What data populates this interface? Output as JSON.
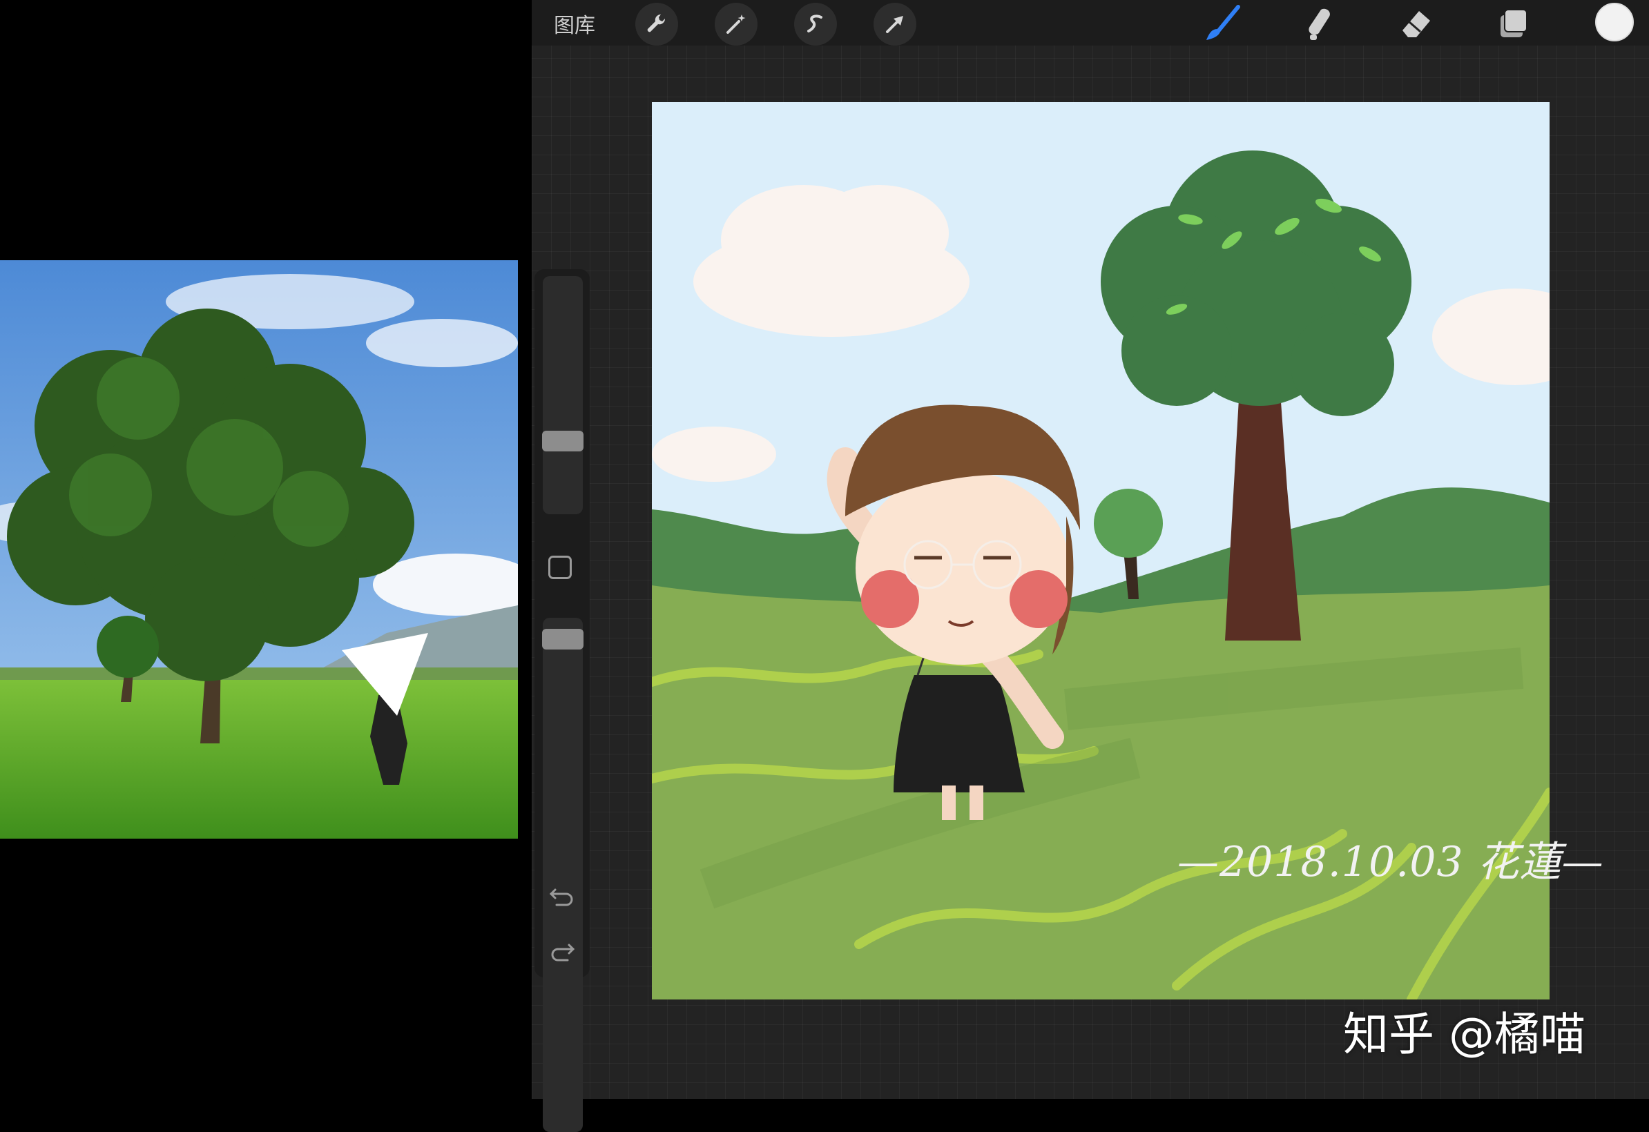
{
  "toolbar": {
    "gallery_label": "图库",
    "left_tools": [
      "wrench-icon",
      "magic-wand-icon",
      "selection-s-icon",
      "arrow-transform-icon"
    ],
    "right_tools": [
      "brush-icon",
      "smudge-icon",
      "eraser-icon",
      "layers-icon"
    ],
    "active_tool": "brush",
    "accent_color": "#2f7ff5",
    "current_color": "#f2f2f2"
  },
  "sidebar": {
    "brush_size_level": 0.68,
    "brush_opacity_level": 0.9,
    "undo_icon": "undo-icon",
    "redo_icon": "redo-icon"
  },
  "artwork": {
    "signature": "—2018.10.03 花蓮—"
  },
  "watermark": "知乎 @橘喵"
}
